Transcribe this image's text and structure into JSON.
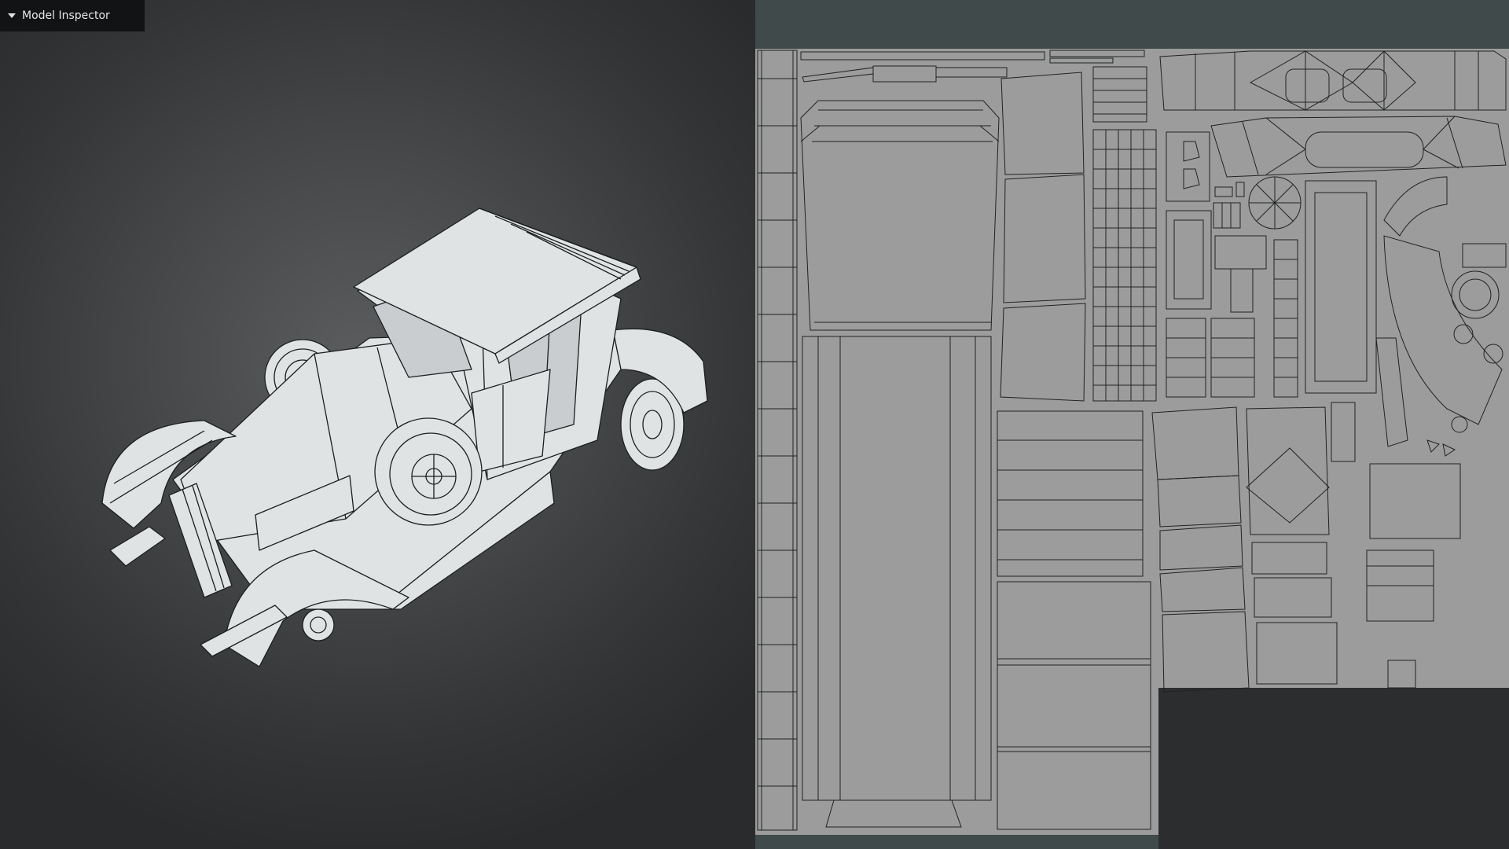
{
  "panel": {
    "title": "Model Inspector",
    "toggle_icon": "caret-down-icon"
  },
  "colors": {
    "viewport_center": "#5a5c5d",
    "viewport_edge": "#2a2b2c",
    "model_fill": "#dfe3e4",
    "wire": "#1c1e1f",
    "uv_background": "#404a4a",
    "uv_tile": "#9c9c9c",
    "uv_empty_region": "#2b2d2e",
    "tab_background": "#111314"
  }
}
